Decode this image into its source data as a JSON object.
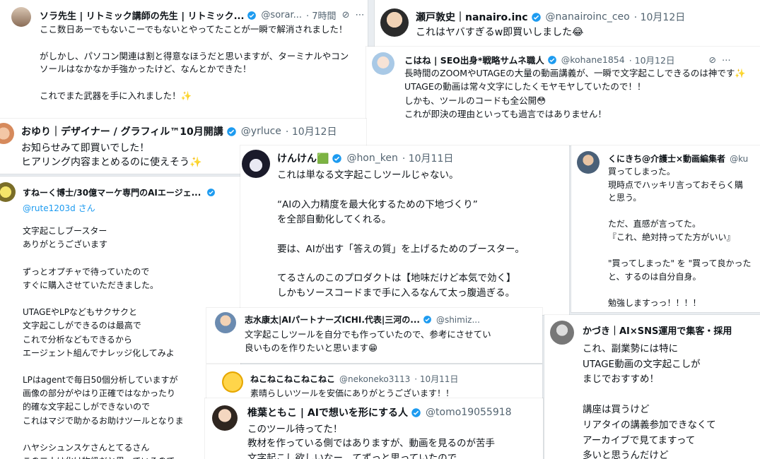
{
  "cards": {
    "sora": {
      "name": "ソラ先生 | リトミック講師の先生 | リトミック...",
      "handle": "@sorar...",
      "time": "· 7時間",
      "text": "ここ数日あーでもないこーでもないとやってたことが一瞬で解消されました！\n\nがしかし、パソコン関連は割と得意なほうだと思いますが、ターミナルやコンソールはなかなか手強かったけど、なんとかできた！\n\nこれでまた武器を手に入れました！✨"
    },
    "seto": {
      "name": "瀬戸敦史｜nanairo.inc",
      "handle": "@nanairoinc_ceo",
      "time": "· 10月12日",
      "text": "これはヤバすぎるw即買いしました😂"
    },
    "kohane": {
      "name": "こはね | SEO出身*戦略サムネ職人",
      "handle": "@kohane1854",
      "time": "· 10月12日",
      "text": "長時間のZOOMやUTAGEの大量の動画講義が、一瞬で文字起こしできるのは神です✨\nUTAGEの動画は常々文字にしたくモヤモヤしていたので！！\nしかも、ツールのコードも全公開😳\nこれが即決の理由といっても過言ではありません！"
    },
    "oyuri": {
      "name": "おゆり｜デザイナー / グラフィル™10月開講",
      "handle": "@yrluce",
      "time": "· 10月12日",
      "text": "お知らせみて即買いでした！\nヒアリング内容まとめるのに使えそう✨"
    },
    "sneak": {
      "name": "すねーく博士/30億マーケ専門のAIエージェ...",
      "reply": "@rute1203d さん",
      "text": "文字起こしブースター\nありがとうございます\n\nずっとオプチャで待っていたので\nすぐに購入させていただきました。\n\nUTAGEやLPなどもサクサクと\n文字起こしができるのは最高で\nこれで分析などもできるから\nエージェント組んでナレッジ化してみよ\n\nLPはagentで毎日50個分析していますが\n画像の部分がやはり正確ではなかったり\n的確な文字起こしができないので\nこれはマジで助かるお助けツールとなりま\n\nハヤシシュンスケさんとてるさん\nこの二人は化け物級だと思っているので"
    },
    "kenken": {
      "name": "けんけん🟩",
      "handle": "@hon_ken",
      "time": "· 10月11日",
      "text": "これは単なる文字起こしツールじゃない。\n\n“AIの入力精度を最大化するための下地づくり”\nを全部自動化してくれる。\n\n要は、AIが出す「答えの質」を上げるためのブースター。\n\nてるさんのこのプロダクトは【地味だけど本気で効く】\nしかもソースコードまで手に入るなんて太っ腹過ぎる。"
    },
    "kunikichi": {
      "name": "くにきち@介護士×動画編集者",
      "handle": "@ku",
      "text": "買ってしまった。\n現時点でハッキリ言っておそらく購\nと思う。\n\nただ、直感が言ってた。\n『これ、絶対持ってた方がいい』\n\n\"買ってしまった\" を \"買って良かった\nと、するのは自分自身。\n\n勉強しますっっ！！！！"
    },
    "shimizu": {
      "name": "志水康太|AIパートナーズICHI.代表|三河の...",
      "handle": "@shimiz...",
      "text": "文字起こしツールを自分でも作っていたので、参考にさせてい\n良いものを作りたいと思います😁"
    },
    "kadgi": {
      "name": "かづき｜AI×SNS運用で集客・採用",
      "text": "これ、副業勢には特に\nUTAGE動画の文字起こしが\nまじでおすすめ！\n\n講座は買うけど\nリアタイの講義参加できなくて\nアーカイブで見てますって\n多いと思うんだけど"
    },
    "neko": {
      "name": "ねこねこねこねこねこ",
      "handle": "@nekoneko3113",
      "time": "· 10月11日",
      "text": "素晴らしいツールを安価にありがとうございます！！"
    },
    "shiiba": {
      "name": "椎葉ともこ | AIで想いを形にする人",
      "handle": "@tomo19055918",
      "text": "このツール待ってた！\n教材を作っている側ではありますが、動画を見るのが苦手\n文字起こし欲しいなー、てずっと思っていたので"
    }
  },
  "icons": {
    "verified": "verified-badge-icon",
    "more": "more-icon",
    "grok": "grok-icon"
  },
  "colors": {
    "verified": "#1d9bf0",
    "secondary": "#536471"
  }
}
